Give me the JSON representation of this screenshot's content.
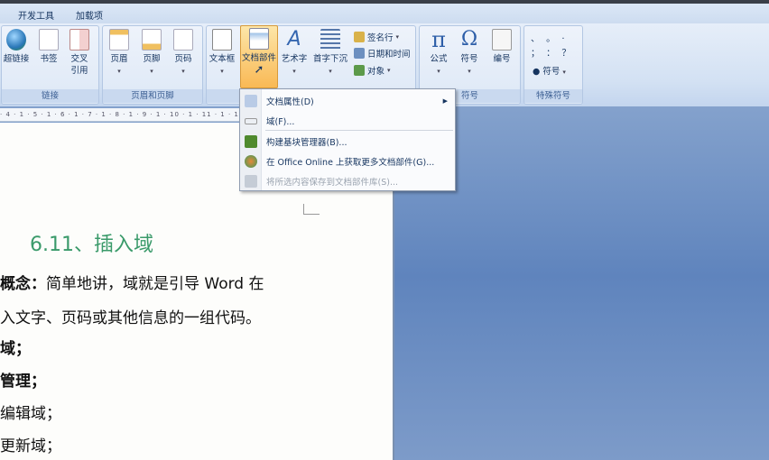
{
  "tabs": [
    "开发工具",
    "加载项"
  ],
  "ribbon": {
    "groups": {
      "links": "链接",
      "header_footer": "页眉和页脚",
      "symbols": "符号",
      "special_symbols": "特殊符号"
    },
    "hyperlink": "超链接",
    "bookmark": "书签",
    "cross_ref": [
      "交叉",
      "引用"
    ],
    "header": "页眉",
    "footer": "页脚",
    "page_number": "页码",
    "textbox": "文本框",
    "quick_parts": "文档部件",
    "wordart": "艺术字",
    "dropcap": "首字下沉",
    "signature": "签名行",
    "datetime": "日期和时间",
    "object": "对象",
    "equation": "公式",
    "symbol": "符号",
    "numbering": "编号",
    "special_symbol": "符号",
    "special_chars": "、 。 ·  ； ： ？"
  },
  "ruler": "· 4 · 1 · 5 · 1 · 6 · 1 · 7 · 1 · 8 · 1 · 9 · 1 · 10 · 1 · 11 · 1 · 12 ·",
  "menu": {
    "items": [
      {
        "label": "文档属性(D)",
        "submenu": true
      },
      {
        "label": "域(F)..."
      },
      {
        "label": "构建基块管理器(B)..."
      },
      {
        "label": "在 Office Online 上获取更多文档部件(G)..."
      },
      {
        "label": "将所选内容保存到文档部件库(S)...",
        "disabled": true
      }
    ]
  },
  "document": {
    "heading": "6.11、插入域",
    "lines": [
      {
        "bold": "概念：",
        "text": "简单地讲，域就是引导 Word 在"
      },
      {
        "bold": "",
        "text": "入文字、页码或其他信息的一组代码。"
      },
      {
        "bold": "域；",
        "text": ""
      },
      {
        "bold": "管理；",
        "text": ""
      },
      {
        "bold": "",
        "text": "编辑域；"
      },
      {
        "bold": "",
        "text": "更新域；"
      }
    ]
  }
}
